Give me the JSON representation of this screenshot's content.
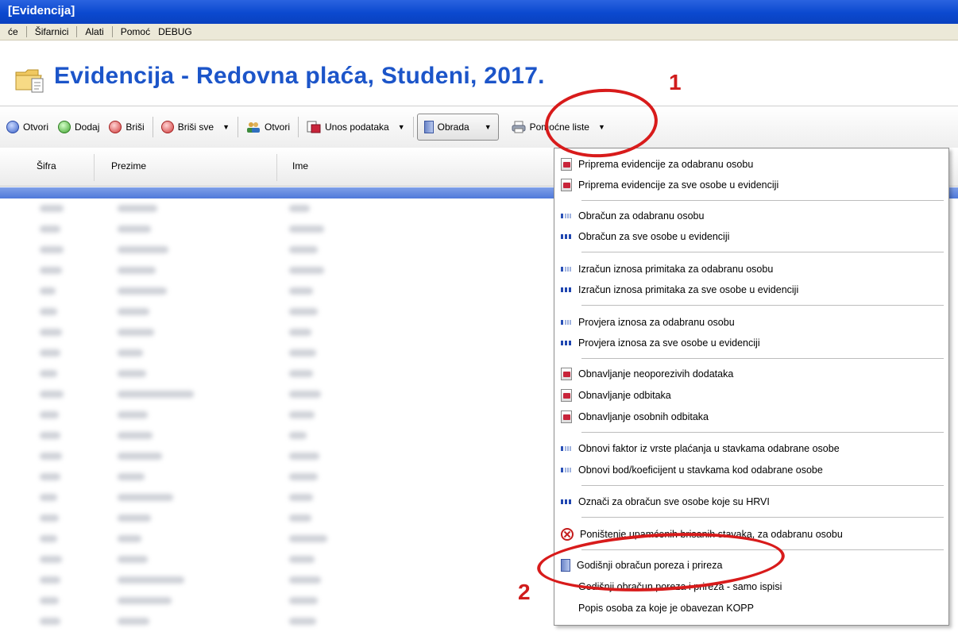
{
  "window": {
    "title": "[Evidencija]"
  },
  "menubar": {
    "items": [
      "će",
      "Šifarnici",
      "Alati",
      "Pomoć",
      "DEBUG"
    ]
  },
  "header": {
    "title": "Evidencija - Redovna plaća, Studeni, 2017."
  },
  "toolbar": {
    "otvori": "Otvori",
    "dodaj": "Dodaj",
    "brisi": "Briši",
    "brisi_sve": "Briši sve",
    "otvori2": "Otvori",
    "unos_podataka": "Unos podataka",
    "obrada": "Obrada",
    "pomocne_liste": "Pomoćne liste"
  },
  "grid": {
    "columns": [
      "Šifra",
      "Prezime",
      "Ime"
    ]
  },
  "menu": {
    "items": [
      "Priprema evidencije za odabranu osobu",
      "Priprema evidencije za sve osobe u evidenciji",
      "Obračun za odabranu osobu",
      "Obračun za sve osobe u evidenciji",
      "Izračun iznosa primitaka za odabranu osobu",
      "Izračun iznosa primitaka za sve osobe u evidenciji",
      "Provjera iznosa za odabranu osobu",
      "Provjera iznosa za sve osobe u evidenciji",
      "Obnavljanje neoporezivih dodataka",
      "Obnavljanje odbitaka",
      "Obnavljanje osobnih odbitaka",
      "Obnovi faktor iz vrste plaćanja u stavkama odabrane osobe",
      "Obnovi bod/koeficijent u stavkama kod odabrane osobe",
      "Označi za obračun sve osobe koje su HRVI",
      "Poništenje upamćenih brisanih stavaka, za odabranu osobu",
      "Godišnji obračun poreza i prireza",
      "Godišnji obračun poreza i prireza - samo ispisi",
      "Popis osoba za koje je obavezan KOPP"
    ]
  },
  "annotations": {
    "one": "1",
    "two": "2"
  },
  "colors": {
    "title_blue": "#1c55c9",
    "annotation_red": "#d81b1b",
    "titlebar": "#0b49cf"
  }
}
